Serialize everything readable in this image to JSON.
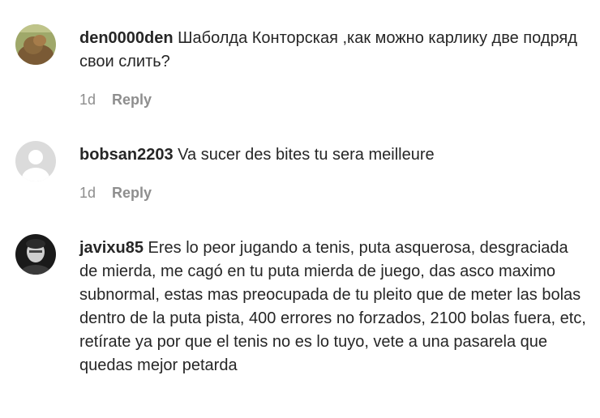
{
  "comments": [
    {
      "username": "den0000den",
      "text": "Шаболда Конторская ,как можно карлику две подряд свои слить?",
      "time": "1d",
      "reply_label": "Reply",
      "avatar": "photo-avatar"
    },
    {
      "username": "bobsan2203",
      "text": "Va sucer des bites tu sera meilleure",
      "time": "1d",
      "reply_label": "Reply",
      "avatar": "default-avatar"
    },
    {
      "username": "javixu85",
      "text": "Eres lo peor jugando a tenis, puta asquerosa, desgraciada de mierda, me cagó en tu puta mierda de juego, das asco maximo subnormal, estas mas preocupada de tu pleito que de meter las bolas dentro de la puta pista, 400 errores no forzados, 2100 bolas fuera, etc, retírate ya por que el tenis no es lo tuyo, vete a una pasarela que quedas mejor petarda",
      "avatar": "photo-avatar"
    }
  ]
}
